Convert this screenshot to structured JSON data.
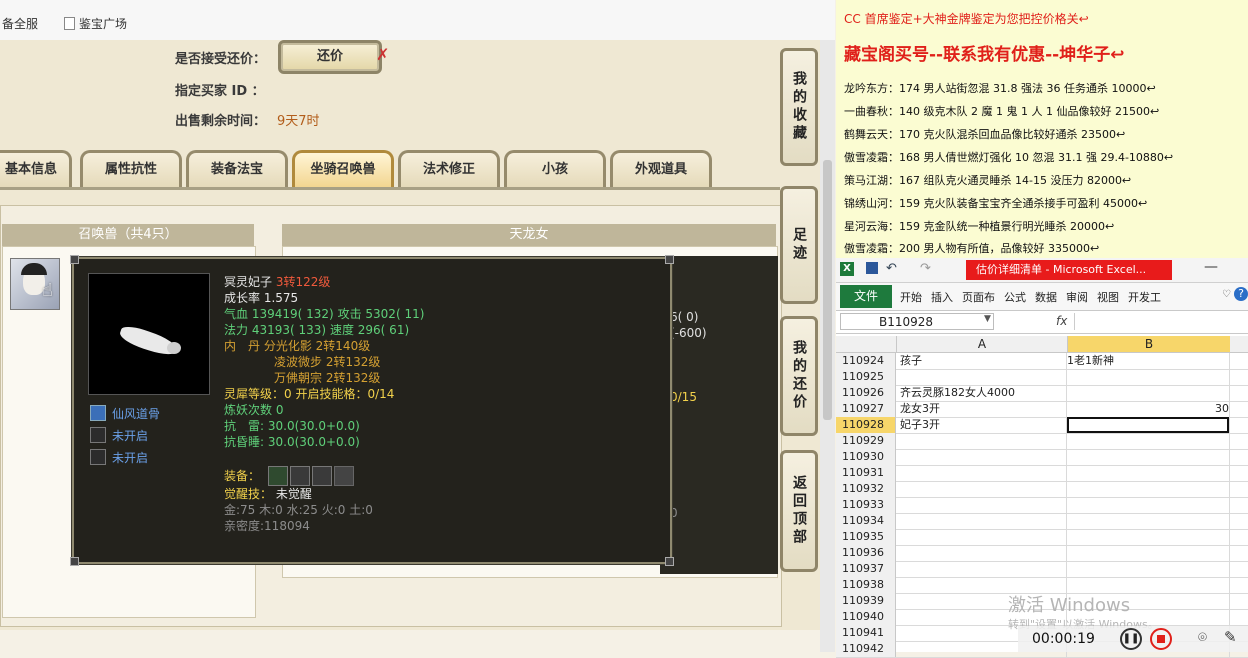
{
  "browser": {
    "bookmarks": [
      "备全服",
      "鉴宝广场"
    ]
  },
  "game": {
    "accept_offer_label": "是否接受还价：",
    "counter_button": "还价",
    "buyer_id_label": "指定买家 ID ：",
    "time_left_label": "出售剩余时间：",
    "time_left_value": "9天7时",
    "tabs": [
      "基本信息",
      "属性抗性",
      "装备法宝",
      "坐骑召唤兽",
      "法术修正",
      "小孩",
      "外观道具"
    ],
    "active_tab": "坐骑召唤兽",
    "pet_panel_title": "召唤兽（共4只）",
    "right_panel_title": "天龙女",
    "side_buttons": [
      "我的收藏",
      "足迹",
      "我的还价",
      "返回顶部"
    ],
    "partial_values": [
      "6( 0)",
      "(-600)",
      "0/15",
      "0"
    ]
  },
  "tooltip": {
    "name": "冥灵妃子",
    "level": "3转122级",
    "growth": "成长率 1.575",
    "hp_label": "气血",
    "hp": "139419( 132)",
    "atk_label": "攻击",
    "atk": "5302( 11)",
    "mp_label": "法力",
    "mp": "43193( 133)",
    "spd_label": "速度",
    "spd": "296( 61)",
    "inner_label": "内　丹",
    "inner1": "分光化影 2转140级",
    "inner2": "凌波微步 2转132级",
    "inner3": "万佛朝宗 2转132级",
    "spirit": "灵犀等级：0 开启技能格：0/14",
    "refine": "炼妖次数 0",
    "resist_thunder": "抗　雷: 30.0(30.0+0.0)",
    "resist_sleep": "抗昏睡: 30.0(30.0+0.0)",
    "equip_label": "装备：",
    "awaken_label": "觉醒技：",
    "awaken_value": "未觉醒",
    "elements": "金:75 木:0 水:25 火:0 土:0",
    "intimacy": "亲密度:118094",
    "skills": [
      "仙风道骨",
      "未开启",
      "未开启"
    ]
  },
  "notes": {
    "header": "CC 首席鉴定+大神金牌鉴定为您把控价格关↩",
    "title": "藏宝阁买号--联系我有优惠--坤华子↩",
    "lines": [
      "龙吟东方：174 男人站街忽混 31.8 强法 36 任务通杀 10000↩",
      "一曲春秋：140 级克木队 2 魔 1 鬼 1 人 1 仙品像较好 21500↩",
      "鹤舞云天：170 克火队混杀回血品像比较好通杀 23500↩",
      "傲雪凌霜：168 男人倩世燃灯强化 10 忽混 31.1 强 29.4-10880↩",
      "策马江湖：167 组队克火通灵睡杀 14-15 没压力 82000↩",
      "锦绣山河：159 克火队装备宝宝齐全通杀接手可盈利 45000↩",
      "星河云海：159 克金队统一种植景行明光睡杀 20000↩",
      "傲雪凌霜：200 男人物有所值，品像较好 335000↩"
    ]
  },
  "excel": {
    "title": "估价详细清单 - Microsoft Excel...",
    "file_tab": "文件",
    "ribbon": [
      "开始",
      "插入",
      "页面布",
      "公式",
      "数据",
      "审阅",
      "视图",
      "开发工"
    ],
    "name_box": "B110928",
    "fx": "fx",
    "col_a": "A",
    "col_b": "B",
    "rows": [
      {
        "n": "110924",
        "a": "孩子",
        "b": "1老1新神"
      },
      {
        "n": "110925",
        "a": "",
        "b": ""
      },
      {
        "n": "110926",
        "a": "齐云灵豚182女人4000",
        "b": ""
      },
      {
        "n": "110927",
        "a": "龙女3开",
        "b": "30"
      },
      {
        "n": "110928",
        "a": "妃子3开",
        "b": ""
      },
      {
        "n": "110929",
        "a": "",
        "b": ""
      },
      {
        "n": "110930",
        "a": "",
        "b": ""
      },
      {
        "n": "110931",
        "a": "",
        "b": ""
      },
      {
        "n": "110932",
        "a": "",
        "b": ""
      },
      {
        "n": "110933",
        "a": "",
        "b": ""
      },
      {
        "n": "110934",
        "a": "",
        "b": ""
      },
      {
        "n": "110935",
        "a": "",
        "b": ""
      },
      {
        "n": "110936",
        "a": "",
        "b": ""
      },
      {
        "n": "110937",
        "a": "",
        "b": ""
      },
      {
        "n": "110938",
        "a": "",
        "b": ""
      },
      {
        "n": "110939",
        "a": "",
        "b": ""
      },
      {
        "n": "110940",
        "a": "",
        "b": ""
      },
      {
        "n": "110941",
        "a": "",
        "b": ""
      },
      {
        "n": "110942",
        "a": "",
        "b": ""
      }
    ]
  },
  "watermark": {
    "line1": "激活 Windows",
    "line2": "转到\"设置\"以激活 Windows。"
  },
  "recorder": {
    "time": "00:00:19"
  }
}
